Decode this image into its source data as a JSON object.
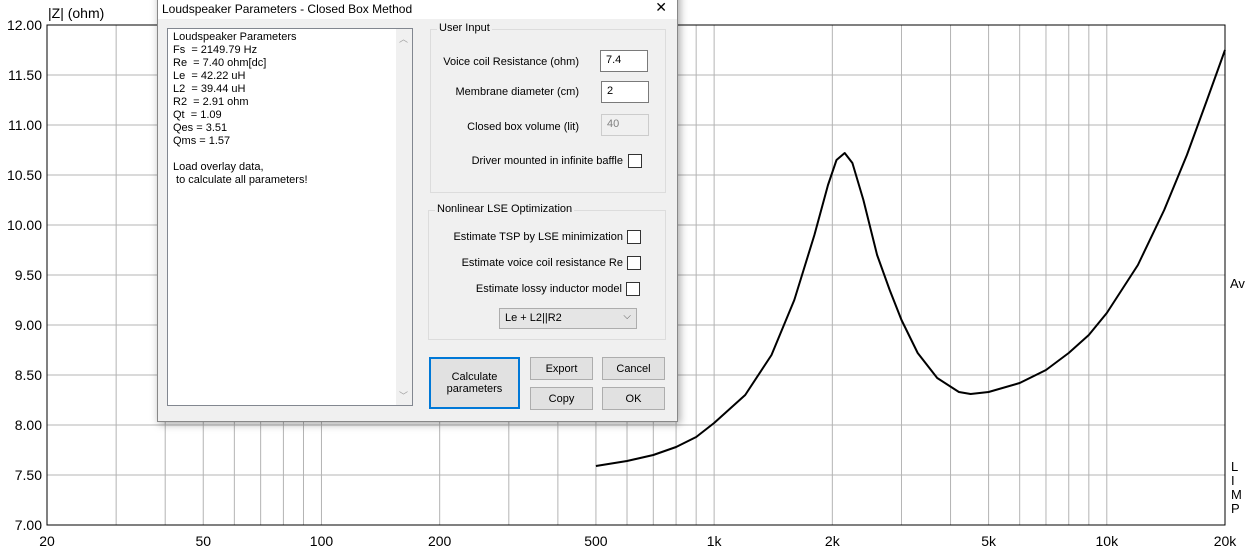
{
  "chart_data": {
    "type": "line",
    "ylabel": "|Z| (ohm)",
    "xscale": "log",
    "xlim": [
      20,
      20000
    ],
    "ylim": [
      7.0,
      12.0
    ],
    "grid": true,
    "yticks": [
      "7.00",
      "7.50",
      "8.00",
      "8.50",
      "9.00",
      "9.50",
      "10.00",
      "10.50",
      "11.00",
      "11.50",
      "12.00"
    ],
    "xtick_values": [
      20,
      50,
      100,
      200,
      500,
      1000,
      2000,
      5000,
      10000,
      20000
    ],
    "xtick_labels": [
      "20",
      "50",
      "100",
      "200",
      "500",
      "1k",
      "2k",
      "5k",
      "10k",
      "20k"
    ],
    "right_labels": {
      "top": "Av",
      "bottom": [
        "L",
        "I",
        "M",
        "P"
      ]
    },
    "series": [
      {
        "name": "LIMP",
        "color": "#000000",
        "x": [
          500,
          600,
          700,
          800,
          900,
          1000,
          1200,
          1400,
          1600,
          1800,
          1950,
          2050,
          2150,
          2250,
          2400,
          2600,
          2800,
          3000,
          3300,
          3700,
          4200,
          4500,
          5000,
          6000,
          7000,
          8000,
          9000,
          10000,
          12000,
          14000,
          16000,
          18000,
          20000
        ],
        "y": [
          7.59,
          7.64,
          7.7,
          7.78,
          7.88,
          8.02,
          8.3,
          8.7,
          9.25,
          9.9,
          10.4,
          10.65,
          10.72,
          10.62,
          10.25,
          9.7,
          9.35,
          9.05,
          8.72,
          8.47,
          8.33,
          8.31,
          8.33,
          8.42,
          8.55,
          8.72,
          8.9,
          9.12,
          9.6,
          10.15,
          10.7,
          11.25,
          11.75
        ]
      }
    ]
  },
  "dialog": {
    "title": "Loudspeaker Parameters - Closed Box Method",
    "results": [
      "Loudspeaker Parameters",
      "Fs  = 2149.79 Hz",
      "Re  = 7.40 ohm[dc]",
      "Le  = 42.22 uH",
      "L2  = 39.44 uH",
      "R2  = 2.91 ohm",
      "Qt  = 1.09",
      "Qes = 3.51",
      "Qms = 1.57",
      "",
      "Load overlay data,",
      " to calculate all parameters!"
    ],
    "user_input": {
      "title": "User Input",
      "re_label": "Voice coil Resistance (ohm)",
      "re_value": "7.4",
      "diam_label": "Membrane diameter (cm)",
      "diam_value": "2",
      "vol_label": "Closed box volume (lit)",
      "vol_value": "40",
      "baffle_label": "Driver mounted in infinite baffle"
    },
    "lse": {
      "title": "Nonlinear LSE Optimization",
      "tsp_label": "Estimate TSP by LSE minimization",
      "re_label": "Estimate voice coil resistance Re",
      "lossy_label": "Estimate lossy inductor model",
      "model": "Le + L2||R2"
    },
    "buttons": {
      "calculate": "Calculate parameters",
      "export": "Export",
      "cancel": "Cancel",
      "copy": "Copy",
      "ok": "OK"
    }
  }
}
